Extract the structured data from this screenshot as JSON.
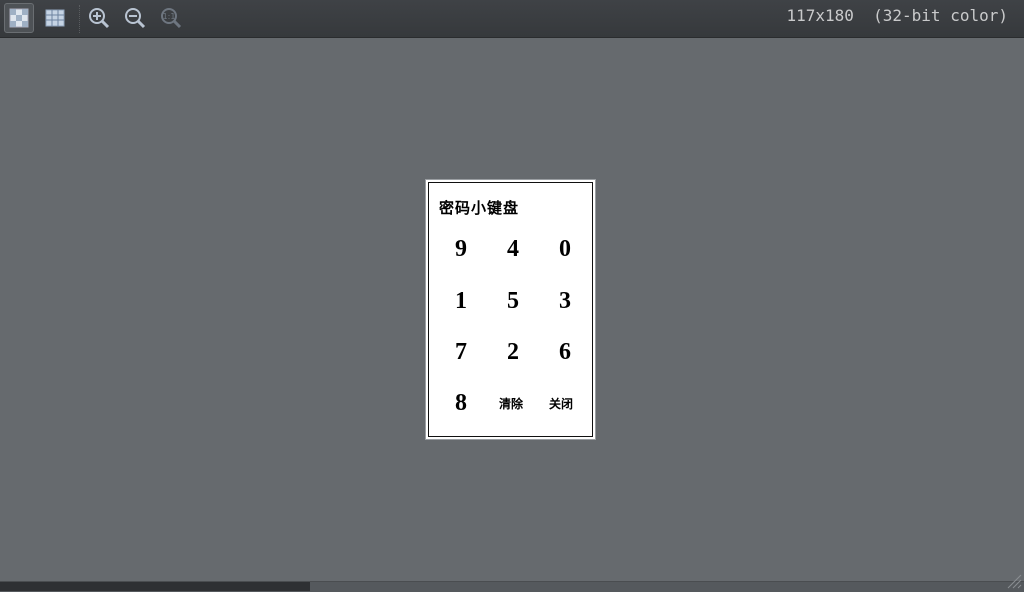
{
  "toolbar": {
    "buttons": [
      {
        "name": "checkerboard-background-button",
        "icon": "checkerboard-icon"
      },
      {
        "name": "grid-toggle-button",
        "icon": "grid-icon"
      },
      {
        "name": "zoom-in-button",
        "icon": "zoom-in-icon"
      },
      {
        "name": "zoom-out-button",
        "icon": "zoom-out-icon"
      },
      {
        "name": "actual-size-button",
        "icon": "zoom-actual-size-icon"
      }
    ],
    "image_info": "117x180  (32-bit color)"
  },
  "keypad": {
    "title": "密码小键盘",
    "keys": [
      "9",
      "4",
      "0",
      "1",
      "5",
      "3",
      "7",
      "2",
      "6",
      "8"
    ],
    "clear_label": "清除",
    "close_label": "关闭"
  },
  "colors": {
    "toolbar_bg": "#3a3d40",
    "canvas_bg": "#666a6e",
    "info_text": "#c9cacb"
  }
}
